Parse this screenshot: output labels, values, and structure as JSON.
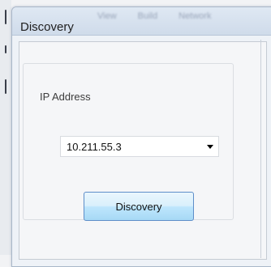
{
  "background_menu": [
    "View",
    "Build",
    "Network"
  ],
  "dialog": {
    "title": "Discovery",
    "group_label": "IP Address",
    "ip_selected": "10.211.55.3",
    "button_label": "Discovery"
  },
  "colors": {
    "button_border": "#5e8ec9",
    "button_fill": "#bee6fd",
    "titlebar": "#d7e2ef"
  }
}
